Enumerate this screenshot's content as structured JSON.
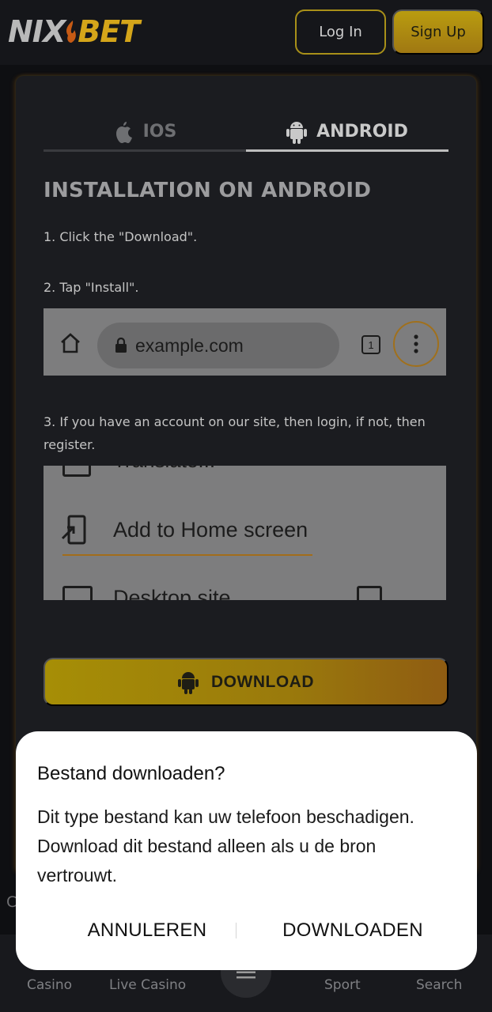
{
  "header": {
    "logo_left": "NIX",
    "logo_right": "BET",
    "login_label": "Log In",
    "signup_label": "Sign Up"
  },
  "tabs": [
    {
      "label": "IOS",
      "icon": "apple-icon",
      "active": false
    },
    {
      "label": "ANDROID",
      "icon": "android-icon",
      "active": true
    }
  ],
  "content": {
    "title": "INSTALLATION ON ANDROID",
    "step1": "1. Click the \"Download\".",
    "step2": "2. Tap \"Install\".",
    "step3": "3. If you have an account on our site, then login, if not, then register.",
    "browser_url": "example.com",
    "browser_tab_count": "1",
    "menu_partial_top": "Translate...",
    "menu_add_home": "Add to Home screen",
    "menu_partial_bottom": "Desktop site",
    "download_label": "DOWNLOAD"
  },
  "bottom_nav": {
    "items": [
      "Casino",
      "Live Casino",
      "Sport",
      "Search"
    ],
    "stray_char": "C"
  },
  "dialog": {
    "title": "Bestand downloaden?",
    "body": "Dit type bestand kan uw telefoon beschadigen. Download dit bestand alleen als u de bron vertrouwt.",
    "cancel_label": "ANNULEREN",
    "confirm_label": "DOWNLOADEN"
  },
  "colors": {
    "accent_gold": "#d4a51a",
    "background": "#0e0f12",
    "card": "#1b1c20",
    "dialog": "#ffffff"
  }
}
